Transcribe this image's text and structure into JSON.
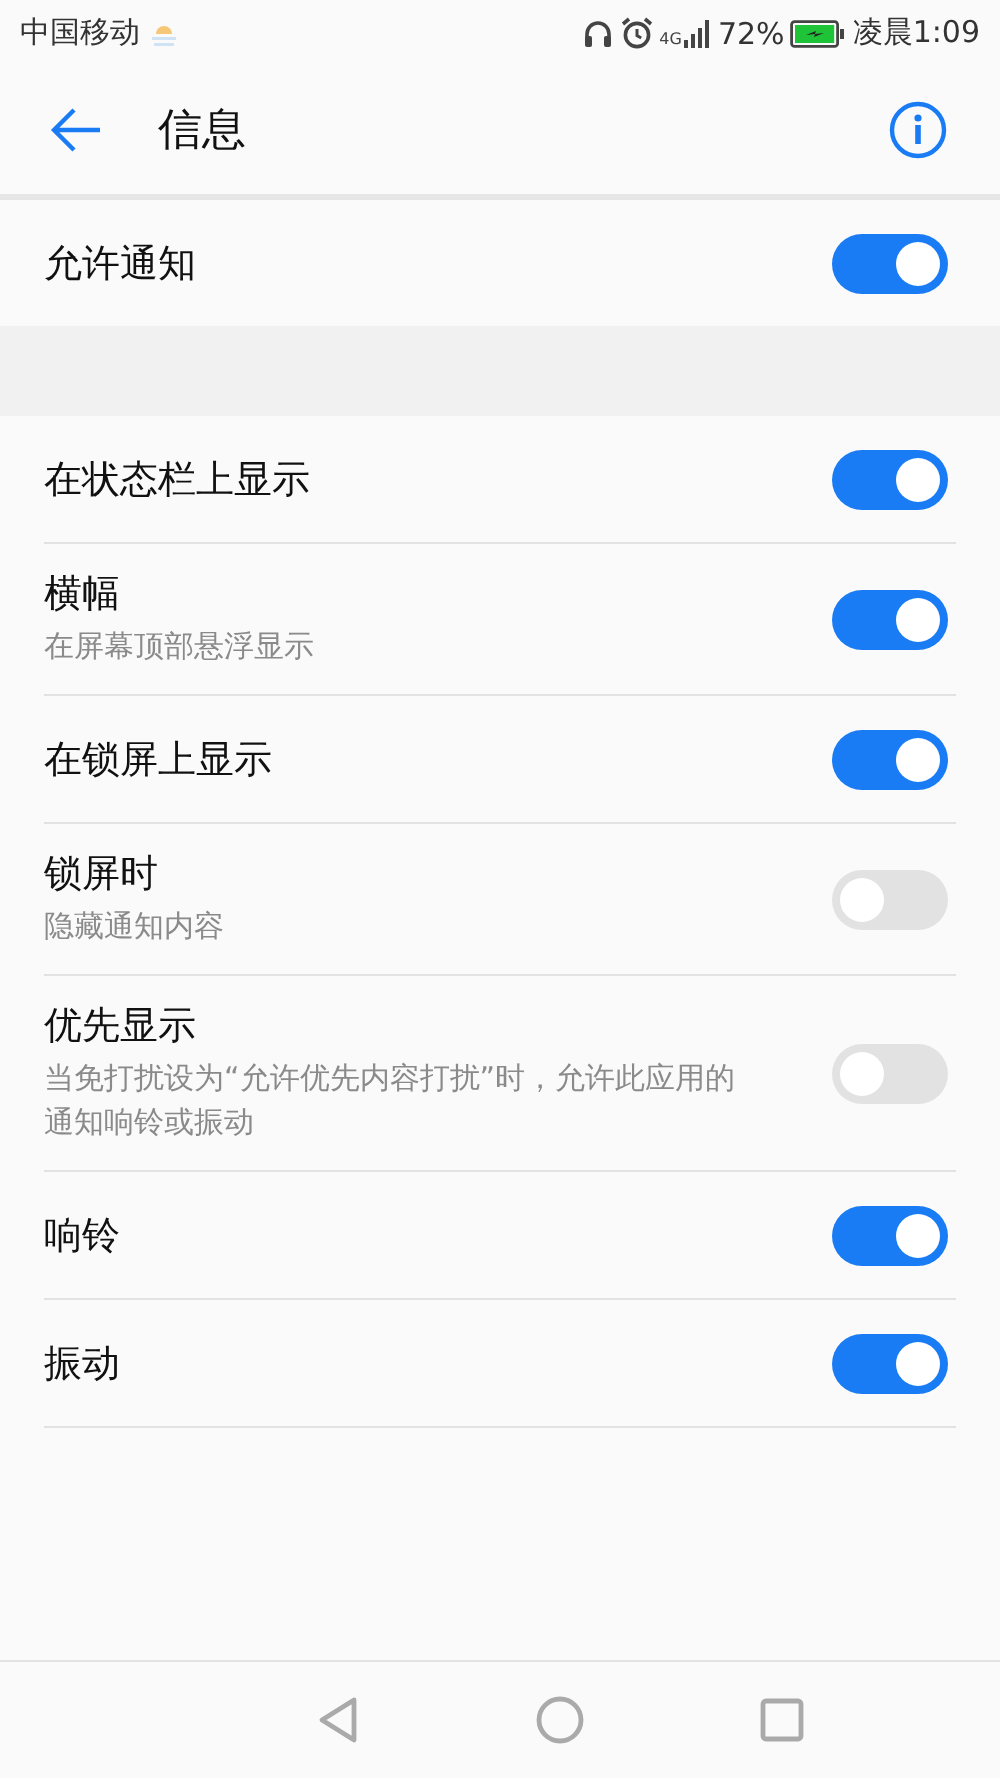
{
  "status_bar": {
    "carrier": "中国移动",
    "network": "4G",
    "battery": "72%",
    "time": "凌晨1:09"
  },
  "toolbar": {
    "title": "信息"
  },
  "sections": [
    {
      "items": [
        {
          "title": "允许通知",
          "on": true
        }
      ]
    },
    {
      "items": [
        {
          "title": "在状态栏上显示",
          "on": true
        },
        {
          "title": "横幅",
          "subtitle": "在屏幕顶部悬浮显示",
          "on": true
        },
        {
          "title": "在锁屏上显示",
          "on": true
        },
        {
          "title": "锁屏时",
          "subtitle": "隐藏通知内容",
          "on": false
        },
        {
          "title": "优先显示",
          "subtitle": "当免打扰设为“允许优先内容打扰”时，允许此应用的通知响铃或振动",
          "on": false
        },
        {
          "title": "响铃",
          "on": true
        },
        {
          "title": "振动",
          "on": true
        }
      ]
    }
  ]
}
